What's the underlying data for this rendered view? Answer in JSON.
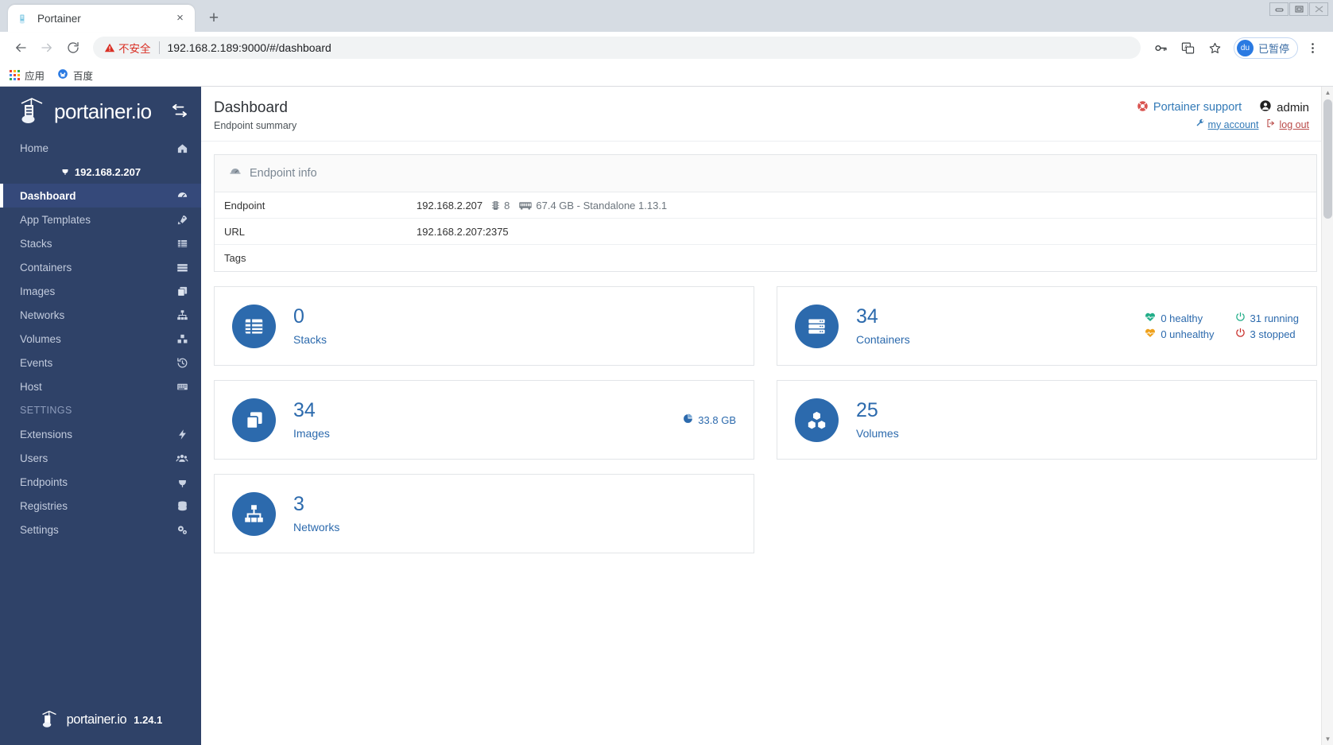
{
  "browser": {
    "tab": {
      "title": "Portainer",
      "favicon": "portainer-favicon",
      "close_label": "×"
    },
    "new_tab_label": "+",
    "window_controls": {
      "minimize": "–",
      "maximize": "□",
      "close": "✕"
    },
    "nav": {
      "back": "←",
      "forward": "→",
      "reload": "↻"
    },
    "omnibox": {
      "security_label": "不安全",
      "url": "192.168.2.189:9000/#/dashboard"
    },
    "toolbar_icons": [
      "key-icon",
      "translate-icon",
      "bookmark-star-icon",
      "menu-dots-icon"
    ],
    "profile": {
      "avatar_text": "du",
      "label": "已暂停"
    },
    "bookmarks": [
      {
        "label": "应用",
        "icon": "apps-grid-icon"
      },
      {
        "label": "百度",
        "icon": "baidu-icon"
      }
    ]
  },
  "sidebar": {
    "brand": "portainer.io",
    "toggle_icon": "collapse-sidebar-icon",
    "items": [
      {
        "label": "Home",
        "icon": "home-icon",
        "active": false
      },
      {
        "label": "Dashboard",
        "icon": "dashboard-icon",
        "active": true
      },
      {
        "label": "App Templates",
        "icon": "rocket-icon",
        "active": false
      },
      {
        "label": "Stacks",
        "icon": "stacks-icon",
        "active": false
      },
      {
        "label": "Containers",
        "icon": "containers-icon",
        "active": false
      },
      {
        "label": "Images",
        "icon": "images-icon",
        "active": false
      },
      {
        "label": "Networks",
        "icon": "networks-icon",
        "active": false
      },
      {
        "label": "Volumes",
        "icon": "volumes-icon",
        "active": false
      },
      {
        "label": "Events",
        "icon": "events-history-icon",
        "active": false
      },
      {
        "label": "Host",
        "icon": "host-icon",
        "active": false
      }
    ],
    "endpoint_badge": {
      "label": "192.168.2.207",
      "icon": "plug-icon"
    },
    "settings_section": "SETTINGS",
    "settings_items": [
      {
        "label": "Extensions",
        "icon": "bolt-icon"
      },
      {
        "label": "Users",
        "icon": "users-icon"
      },
      {
        "label": "Endpoints",
        "icon": "plug-icon"
      },
      {
        "label": "Registries",
        "icon": "database-icon"
      },
      {
        "label": "Settings",
        "icon": "cogs-icon"
      }
    ],
    "footer": {
      "brand": "portainer.io",
      "version": "1.24.1"
    }
  },
  "header": {
    "title": "Dashboard",
    "subtitle": "Endpoint summary",
    "support_link": "Portainer support",
    "support_icon": "lifebuoy-icon",
    "user_label": "admin",
    "user_icon": "user-circle-icon",
    "my_account_link": "my account",
    "my_account_icon": "wrench-icon",
    "logout_link": "log out",
    "logout_icon": "sign-out-icon"
  },
  "endpoint_info": {
    "panel_title": "Endpoint info",
    "panel_icon": "tachometer-icon",
    "rows": [
      {
        "key": "Endpoint",
        "value": "192.168.2.207",
        "cpu_icon": "cpu-icon",
        "cpu": "8",
        "memory_icon": "memory-icon",
        "memory": "67.4 GB - Standalone 1.13.1"
      },
      {
        "key": "URL",
        "value": "192.168.2.207:2375"
      },
      {
        "key": "Tags",
        "value": ""
      }
    ]
  },
  "cards": {
    "left": [
      {
        "count": "0",
        "label": "Stacks",
        "icon": "stacks-icon"
      },
      {
        "count": "34",
        "label": "Images",
        "icon": "images-icon",
        "size_icon": "pie-chart-icon",
        "size": "33.8 GB"
      },
      {
        "count": "3",
        "label": "Networks",
        "icon": "networks-icon"
      }
    ],
    "right": [
      {
        "count": "34",
        "label": "Containers",
        "icon": "containers-icon",
        "stats": [
          {
            "icon": "heartbeat-icon",
            "label": "0 healthy",
            "color": "#23ae89"
          },
          {
            "icon": "power-icon",
            "label": "31 running",
            "color": "#23ae89"
          },
          {
            "icon": "heartbeat-icon",
            "label": "0 unhealthy",
            "color": "#efa11b"
          },
          {
            "icon": "power-icon",
            "label": "3 stopped",
            "color": "#c9302c"
          }
        ]
      },
      {
        "count": "25",
        "label": "Volumes",
        "icon": "volumes-icon"
      }
    ]
  },
  "colors": {
    "sidebar_bg": "#2f4268",
    "sidebar_active": "#35497a",
    "accent_blue": "#2c6aad",
    "healthy_green": "#23ae89",
    "unhealthy_orange": "#efa11b",
    "stopped_red": "#c9302c",
    "link_blue": "#337ab7",
    "insecure_red": "#d93025"
  }
}
